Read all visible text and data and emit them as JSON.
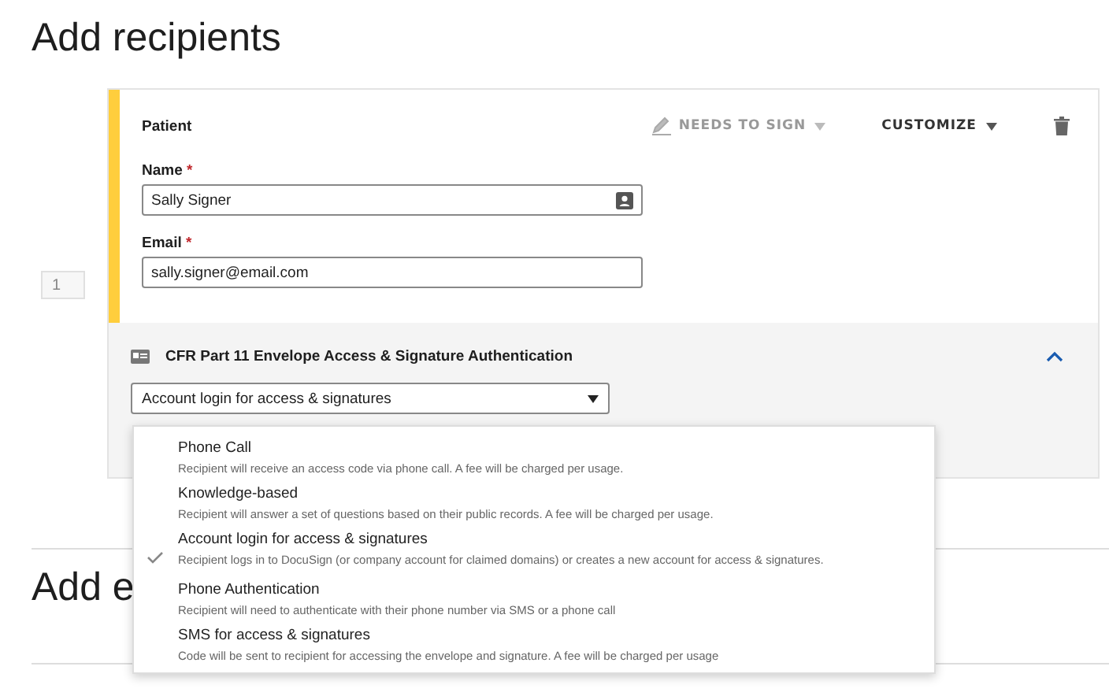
{
  "page_title": "Add recipients",
  "recipient": {
    "number": "1",
    "role": "Patient",
    "action": "NEEDS TO SIGN",
    "customize": "CUSTOMIZE",
    "fields": [
      {
        "label": "Name",
        "required_mark": "*",
        "value": "Sally Signer",
        "kind": "contact"
      },
      {
        "label": "Email",
        "required_mark": "*",
        "value": "sally.signer@email.com",
        "kind": "plain"
      }
    ],
    "auth": {
      "title": "CFR Part 11 Envelope Access & Signature Authentication",
      "expanded": true,
      "value": "Account login for access & signatures",
      "options": [
        {
          "label": "Phone Call",
          "description": "Recipient will receive an access code via phone call. A fee will be charged per usage.",
          "selected": false
        },
        {
          "label": "Knowledge-based",
          "description": "Recipient will answer a set of questions based on their public records. A fee will be charged per usage.",
          "selected": false
        },
        {
          "label": "Account login for access & signatures",
          "description": "Recipient logs in to DocuSign (or company account for claimed domains) or creates a new account for access & signatures.",
          "selected": true
        },
        {
          "label": "Phone Authentication",
          "description": "Recipient will need to authenticate with their phone number via SMS or a phone call",
          "selected": false
        },
        {
          "label": "SMS for access & signatures",
          "description": "Code will be sent to recipient for accessing the envelope and signature. A fee will be charged per usage",
          "selected": false
        }
      ]
    }
  },
  "next_section_title": "Add e"
}
